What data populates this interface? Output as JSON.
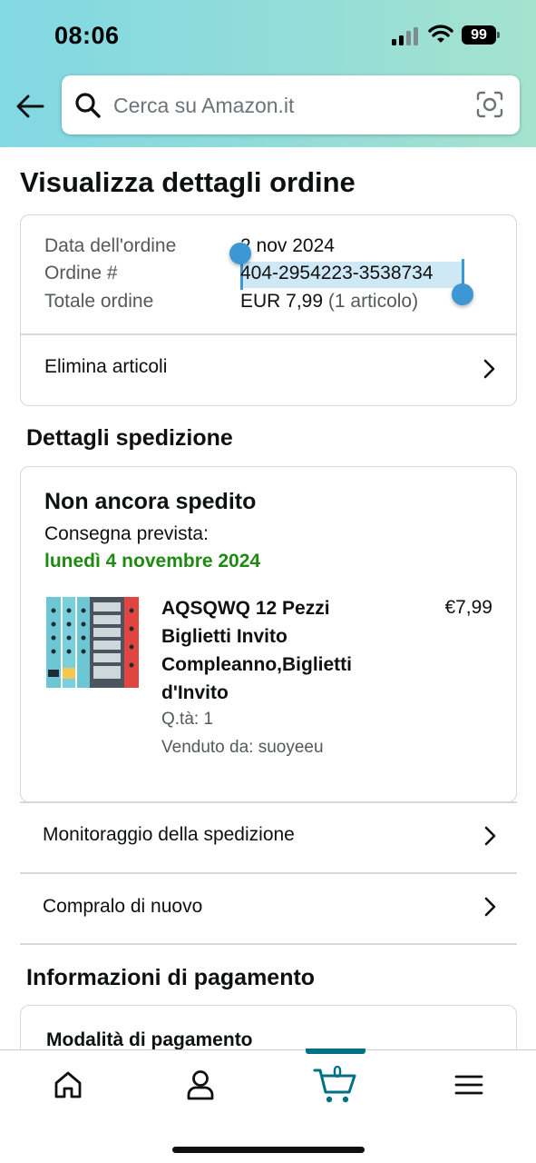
{
  "status_bar": {
    "time": "08:06",
    "battery": "99"
  },
  "search": {
    "placeholder": "Cerca su Amazon.it"
  },
  "page": {
    "title": "Visualizza dettagli ordine"
  },
  "order_info": {
    "rows": [
      {
        "label": "Data dell'ordine",
        "value": "2 nov 2024"
      },
      {
        "label": "Ordine #",
        "value": "404-2954223-3538734"
      },
      {
        "label": "Totale ordine",
        "value": "EUR 7,99",
        "suffix": "(1 articolo)"
      }
    ],
    "delete_items_label": "Elimina articoli"
  },
  "shipping": {
    "section_title": "Dettagli spedizione",
    "status": "Non ancora spedito",
    "delivery_label": "Consegna prevista:",
    "delivery_date": "lunedì 4 novembre 2024",
    "item": {
      "title": "AQSQWQ 12 Pezzi Biglietti Invito Compleanno,Biglietti d'Invito",
      "price": "€7,99",
      "quantity": "Q.tà: 1",
      "seller": "Venduto da: suoyeeu"
    },
    "track_label": "Monitoraggio della spedizione",
    "buy_again_label": "Compralo di nuovo"
  },
  "payment": {
    "section_title": "Informazioni di pagamento",
    "method_label": "Modalità di pagamento"
  },
  "bottom_nav": {
    "items": [
      "home-icon",
      "account-icon",
      "cart-icon",
      "menu-icon"
    ],
    "cart_count": "0",
    "accent_color": "#007185"
  },
  "colors": {
    "delivery_green": "#1f8a12",
    "selection_blue": "#3c97d3"
  }
}
